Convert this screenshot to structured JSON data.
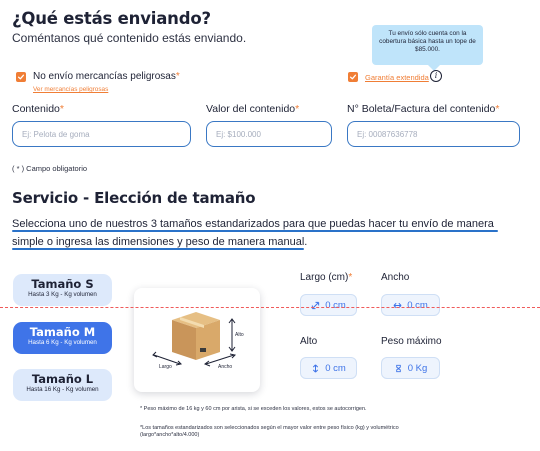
{
  "header": {
    "title": "¿Qué estás enviando?",
    "subtitle": "Coméntanos qué contenido estás enviando."
  },
  "tooltip": {
    "text": "Tu envío sólo cuenta con la cobertura básica hasta un tope de $85.000."
  },
  "options": {
    "dangerous_goods_label": "No envío mercancías peligrosas",
    "dangerous_goods_link": "Ver mercancías peligrosas",
    "guarantee_label": "Garantía extendida",
    "required_mark": "*",
    "checked": true
  },
  "fields": [
    {
      "label": "Contenido",
      "placeholder": "Ej: Pelota de goma"
    },
    {
      "label": "Valor del contenido",
      "placeholder": "Ej: $100.000"
    },
    {
      "label": "N° Boleta/Factura del contenido",
      "placeholder": "Ej: 00087636778"
    }
  ],
  "required_note": "( * ) Campo obligatorio",
  "service": {
    "title": "Servicio - Elección de tamaño",
    "description": "Selecciona uno de nuestros 3 tamaños estandarizados para que puedas hacer tu envío de manera simple o ingresa las dimensiones y peso de manera manual."
  },
  "sizes": [
    {
      "name": "Tamaño S",
      "detail": "Hasta 3 Kg - Kg volumen",
      "selected": false
    },
    {
      "name": "Tamaño M",
      "detail": "Hasta 6 Kg - Kg volumen",
      "selected": true
    },
    {
      "name": "Tamaño L",
      "detail": "Hasta 16 Kg - Kg volumen",
      "selected": false
    }
  ],
  "box_illustration": {
    "alto": "Alto",
    "largo": "Largo",
    "ancho": "Ancho"
  },
  "dimensions": {
    "largo": {
      "label": "Largo (cm)",
      "value": "0 cm"
    },
    "ancho": {
      "label": "Ancho",
      "value": "0 cm"
    },
    "alto": {
      "label": "Alto",
      "value": "0 cm"
    },
    "peso": {
      "label": "Peso máximo",
      "value": "0 Kg"
    }
  },
  "notes": {
    "max": "* Peso máximo de 16 kg y 60 cm por arista, si se exceden los valores, estos se autocorrigen.",
    "sizes": "*Los tamaños estandarizados son seleccionados según el mayor valor entre peso físico (kg) y volumétrico (largo*ancho*alto/4.000)"
  },
  "colors": {
    "accent_orange": "#f07e36",
    "primary_blue": "#3f74e8",
    "tooltip_blue": "#bfe4fa",
    "dashed_red": "#ef5a5a"
  },
  "icons": {
    "checkbox": "check-icon",
    "info": "info-icon",
    "largo": "diagonal-arrows-icon",
    "ancho": "horizontal-arrows-icon",
    "alto": "vertical-arrows-icon",
    "peso": "weight-icon"
  }
}
